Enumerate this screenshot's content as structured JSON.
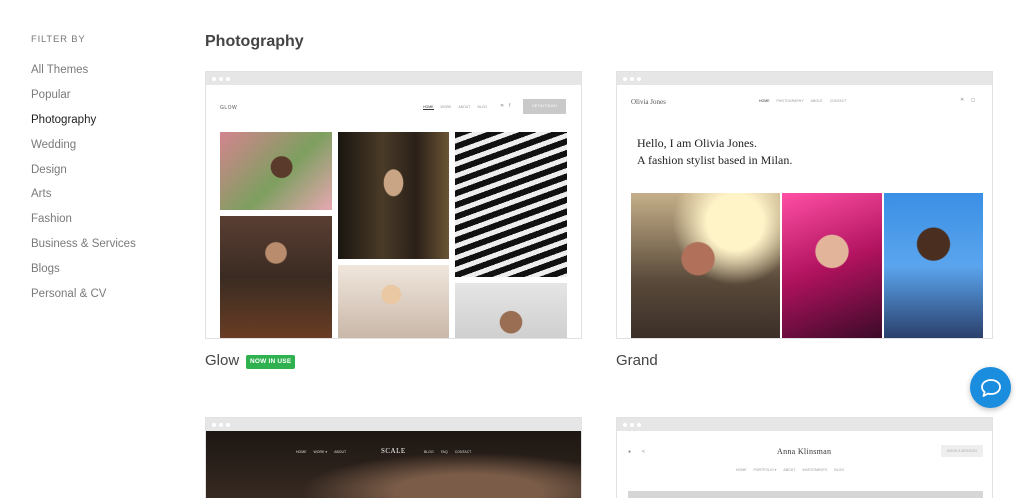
{
  "sidebar": {
    "heading": "FILTER BY",
    "items": [
      {
        "label": "All Themes",
        "active": false
      },
      {
        "label": "Popular",
        "active": false
      },
      {
        "label": "Photography",
        "active": true
      },
      {
        "label": "Wedding",
        "active": false
      },
      {
        "label": "Design",
        "active": false
      },
      {
        "label": "Arts",
        "active": false
      },
      {
        "label": "Fashion",
        "active": false
      },
      {
        "label": "Business & Services",
        "active": false
      },
      {
        "label": "Blogs",
        "active": false
      },
      {
        "label": "Personal & CV",
        "active": false
      }
    ]
  },
  "section_title": "Photography",
  "themes": {
    "glow": {
      "name": "Glow",
      "badge": "NOW IN USE",
      "preview": {
        "logo": "GLOW",
        "nav": [
          "HOME",
          "WORK",
          "ABOUT",
          "BLOG"
        ],
        "cta": "GET IN TOUCH"
      }
    },
    "grand": {
      "name": "Grand",
      "preview": {
        "logo": "Olivia Jones",
        "nav": [
          "HOME",
          "PHOTOGRAPHY",
          "ABOUT",
          "CONTACT"
        ],
        "headline_1": "Hello, I am Olivia Jones.",
        "headline_2": "A fashion stylist based in Milan."
      }
    },
    "scale": {
      "preview": {
        "logo": "SCALE",
        "nav_left": [
          "HOME",
          "WORK ▾",
          "ABOUT"
        ],
        "nav_right": [
          "BLOG",
          "FAQ",
          "CONTACT"
        ]
      }
    },
    "anna": {
      "preview": {
        "logo": "Anna Klinsman",
        "nav": [
          "HOME",
          "PORTFOLIO ▾",
          "ABOUT",
          "INVESTMENTS",
          "BLOG"
        ],
        "cta": "BOOK A SESSION"
      }
    }
  },
  "icons": {
    "chat": "chat-bubble-icon"
  },
  "colors": {
    "badge": "#2fb14f",
    "chat": "#1a8ddf"
  }
}
